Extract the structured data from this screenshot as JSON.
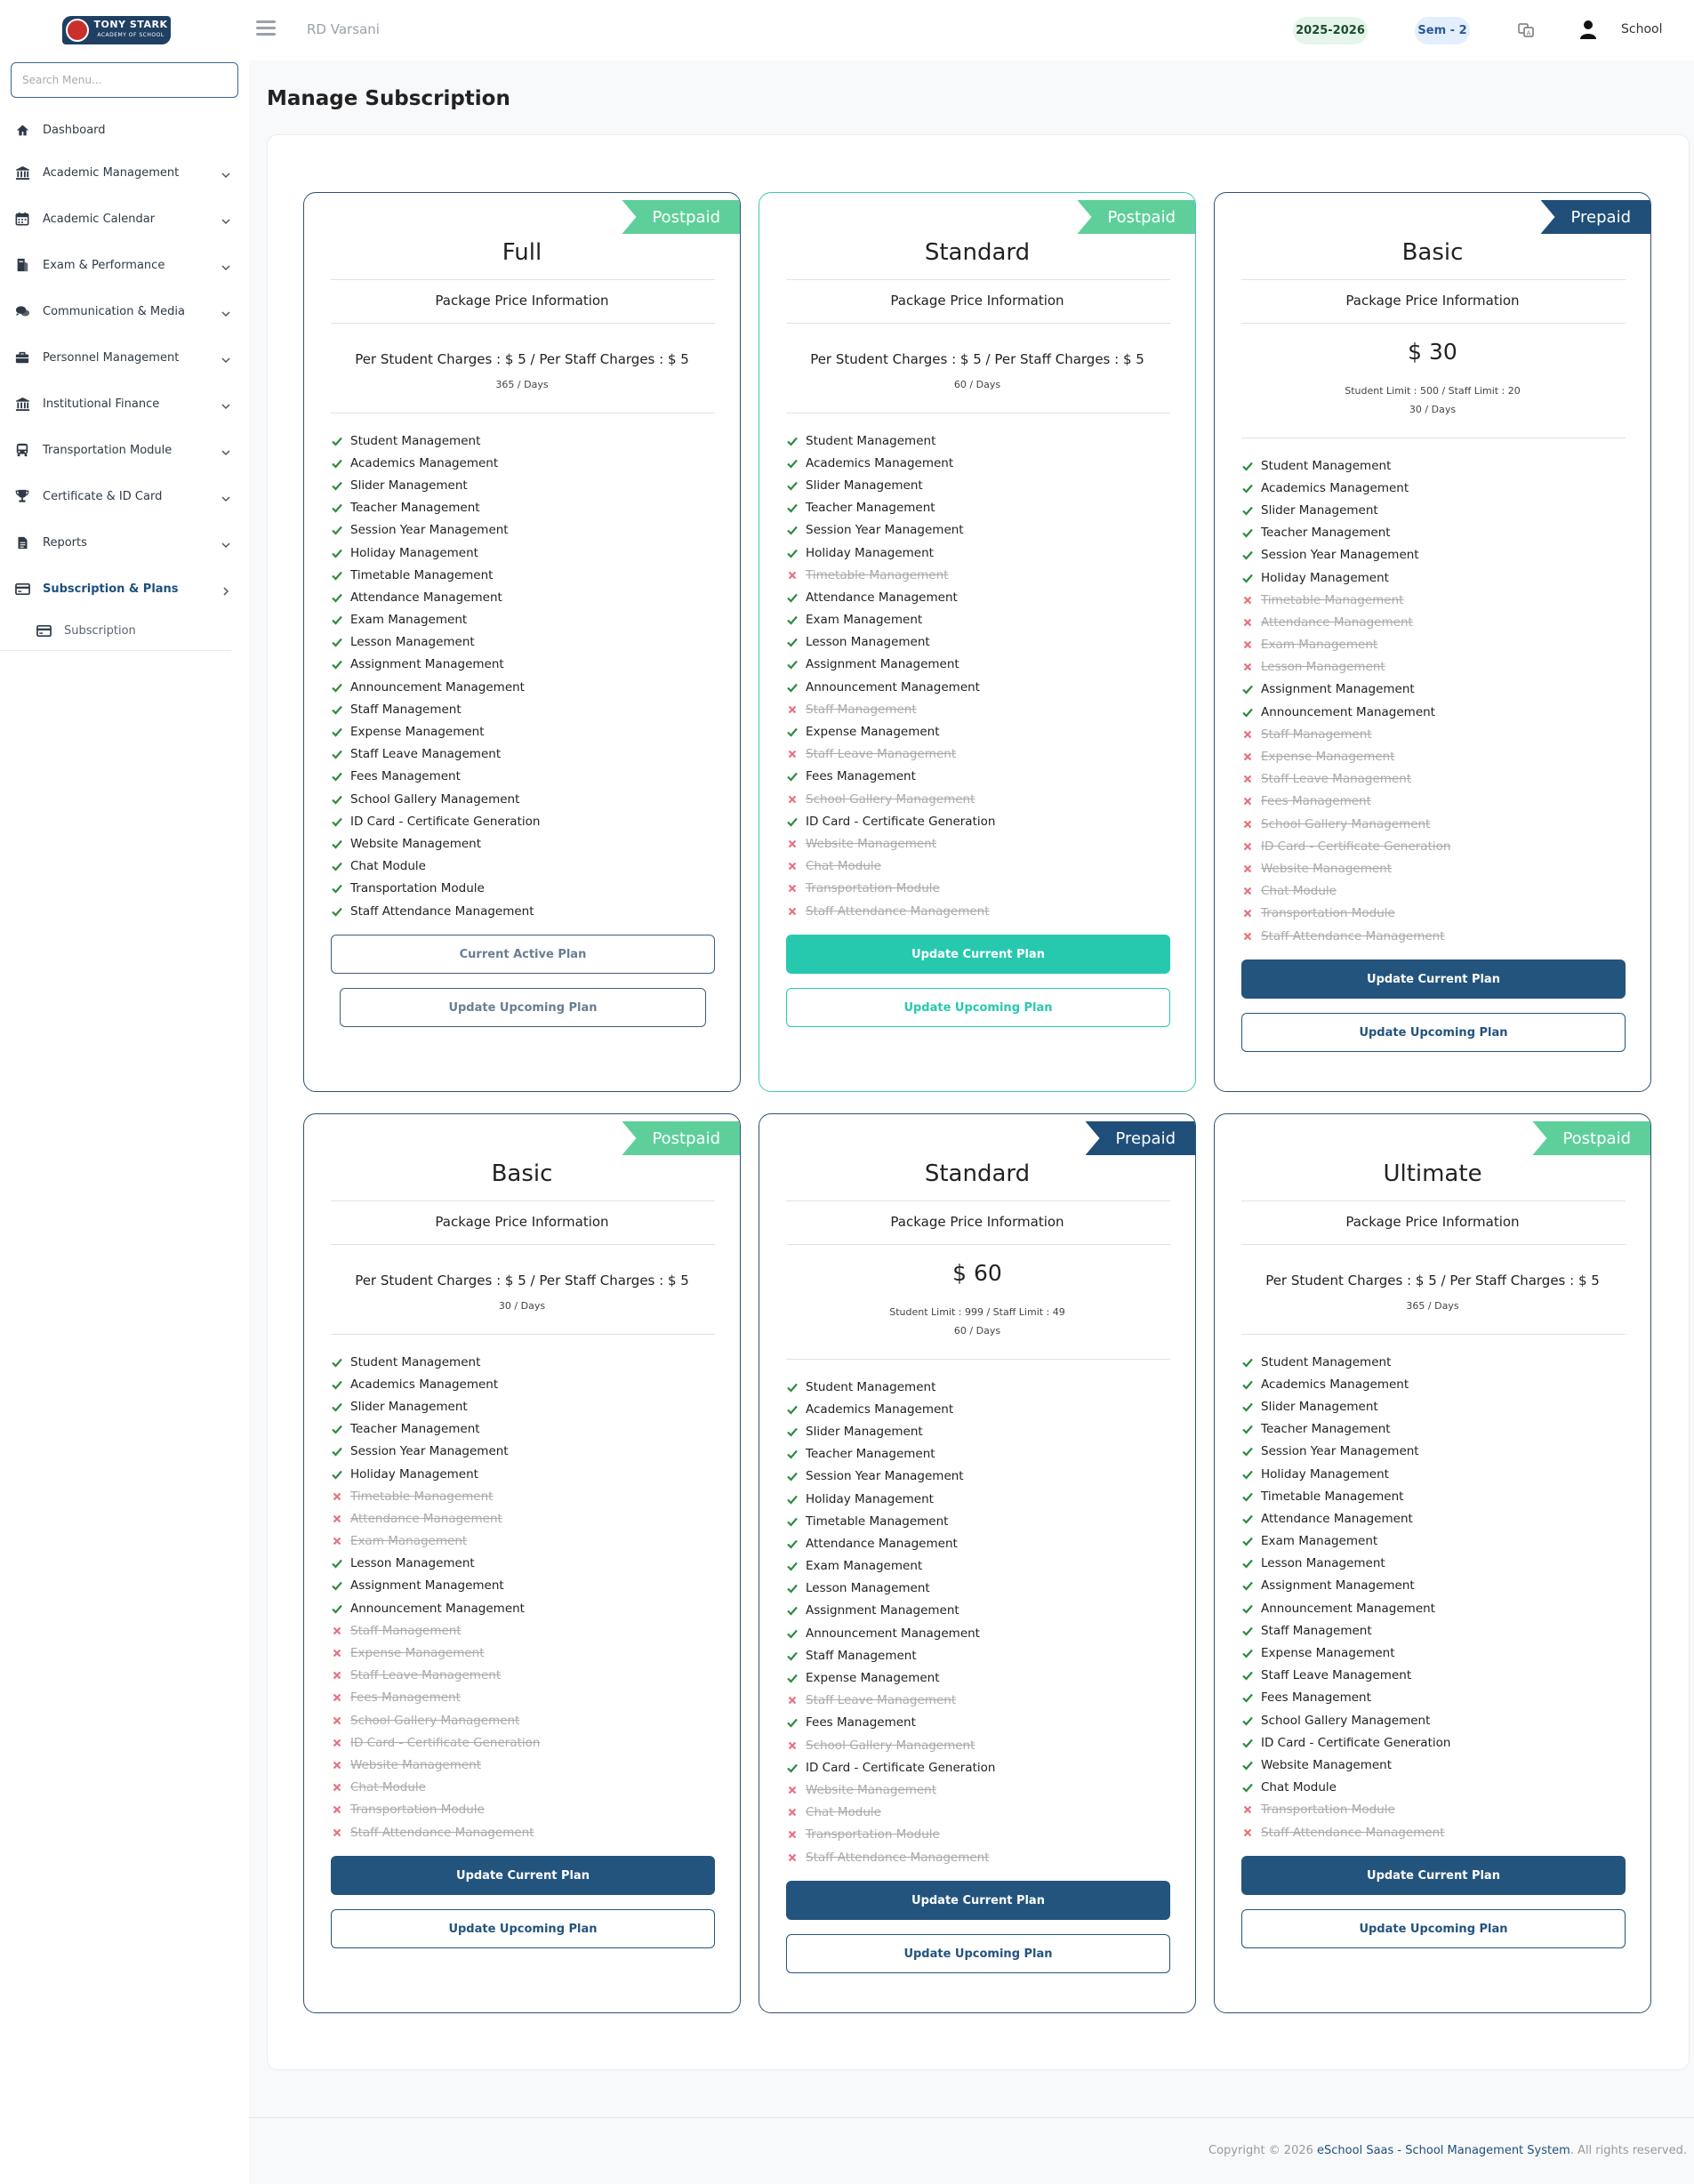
{
  "topbar": {
    "logo_text": "TONY STARK",
    "logo_sub": "ACADEMY OF SCHOOL",
    "school_name": "RD Varsani",
    "session_year": "2025-2026",
    "semester": "Sem - 2",
    "user_label": "School"
  },
  "sidebar": {
    "search_placeholder": "Search Menu...",
    "items": [
      {
        "label": "Dashboard",
        "icon": "home-icon"
      },
      {
        "label": "Academic Management",
        "icon": "bank-icon"
      },
      {
        "label": "Academic Calendar",
        "icon": "calendar-icon"
      },
      {
        "label": "Exam & Performance",
        "icon": "book-icon"
      },
      {
        "label": "Communication & Media",
        "icon": "chat-icon"
      },
      {
        "label": "Personnel Management",
        "icon": "briefcase-icon"
      },
      {
        "label": "Institutional Finance",
        "icon": "bank-icon"
      },
      {
        "label": "Transportation Module",
        "icon": "bus-icon"
      },
      {
        "label": "Certificate & ID Card",
        "icon": "trophy-icon"
      },
      {
        "label": "Reports",
        "icon": "file-icon"
      },
      {
        "label": "Subscription & Plans",
        "icon": "credit-card-icon"
      }
    ],
    "sub_item": "Subscription"
  },
  "page": {
    "title": "Manage Subscription"
  },
  "plans": [
    {
      "name": "Full",
      "type": "Postpaid",
      "package_info": "Package Price Information",
      "charges": "Per Student Charges : $ 5 / Per Staff Charges : $ 5",
      "days": "365 / Days",
      "features_on": [
        1,
        1,
        1,
        1,
        1,
        1,
        1,
        1,
        1,
        1,
        1,
        1,
        1,
        1,
        1,
        1,
        1,
        1,
        1,
        1,
        1,
        1
      ],
      "btn1": "Current Active Plan",
      "btn2": "Update Upcoming Plan"
    },
    {
      "name": "Standard",
      "type": "Postpaid",
      "package_info": "Package Price Information",
      "charges": "Per Student Charges : $ 5 / Per Staff Charges : $ 5",
      "days": "60 / Days",
      "features_on": [
        1,
        1,
        1,
        1,
        1,
        1,
        0,
        1,
        1,
        1,
        1,
        1,
        0,
        1,
        0,
        1,
        0,
        1,
        0,
        0,
        0,
        0
      ],
      "btn1": "Update Current Plan",
      "btn2": "Update Upcoming Plan"
    },
    {
      "name": "Basic",
      "type": "Prepaid",
      "package_info": "Package Price Information",
      "price": "$ 30",
      "limits": "Student Limit : 500 / Staff Limit : 20",
      "days": "30 / Days",
      "features_on": [
        1,
        1,
        1,
        1,
        1,
        1,
        0,
        0,
        0,
        0,
        1,
        1,
        0,
        0,
        0,
        0,
        0,
        0,
        0,
        0,
        0,
        0
      ],
      "btn1": "Update Current Plan",
      "btn2": "Update Upcoming Plan"
    },
    {
      "name": "Basic",
      "type": "Postpaid",
      "package_info": "Package Price Information",
      "charges": "Per Student Charges : $ 5 / Per Staff Charges : $ 5",
      "days": "30 / Days",
      "features_on": [
        1,
        1,
        1,
        1,
        1,
        1,
        0,
        0,
        0,
        1,
        1,
        1,
        0,
        0,
        0,
        0,
        0,
        0,
        0,
        0,
        0,
        0
      ],
      "btn1": "Update Current Plan",
      "btn2": "Update Upcoming Plan"
    },
    {
      "name": "Standard",
      "type": "Prepaid",
      "package_info": "Package Price Information",
      "price": "$ 60",
      "limits": "Student Limit : 999 / Staff Limit : 49",
      "days": "60 / Days",
      "features_on": [
        1,
        1,
        1,
        1,
        1,
        1,
        1,
        1,
        1,
        1,
        1,
        1,
        1,
        1,
        0,
        1,
        0,
        1,
        0,
        0,
        0,
        0
      ],
      "btn1": "Update Current Plan",
      "btn2": "Update Upcoming Plan"
    },
    {
      "name": "Ultimate",
      "type": "Postpaid",
      "package_info": "Package Price Information",
      "charges": "Per Student Charges : $ 5 / Per Staff Charges : $ 5",
      "days": "365 / Days",
      "features_on": [
        1,
        1,
        1,
        1,
        1,
        1,
        1,
        1,
        1,
        1,
        1,
        1,
        1,
        1,
        1,
        1,
        1,
        1,
        1,
        1,
        0,
        0
      ],
      "btn1": "Update Current Plan",
      "btn2": "Update Upcoming Plan"
    }
  ],
  "feature_names": [
    "Student Management",
    "Academics Management",
    "Slider Management",
    "Teacher Management",
    "Session Year Management",
    "Holiday Management",
    "Timetable Management",
    "Attendance Management",
    "Exam Management",
    "Lesson Management",
    "Assignment Management",
    "Announcement Management",
    "Staff Management",
    "Expense Management",
    "Staff Leave Management",
    "Fees Management",
    "School Gallery Management",
    "ID Card - Certificate Generation",
    "Website Management",
    "Chat Module",
    "Transportation Module",
    "Staff Attendance Management"
  ],
  "footer": {
    "prefix": "Copyright © 2026 ",
    "brand": "eSchool Saas - School Management System",
    "suffix": ". All rights reserved."
  },
  "colors": {
    "navy": "#23547d",
    "teal": "#27c9ae",
    "postpaid_ribbon": "#5ecf9a",
    "prepaid_ribbon": "#1f4f78",
    "check": "#2e8b3f",
    "cross": "#e8707f"
  }
}
